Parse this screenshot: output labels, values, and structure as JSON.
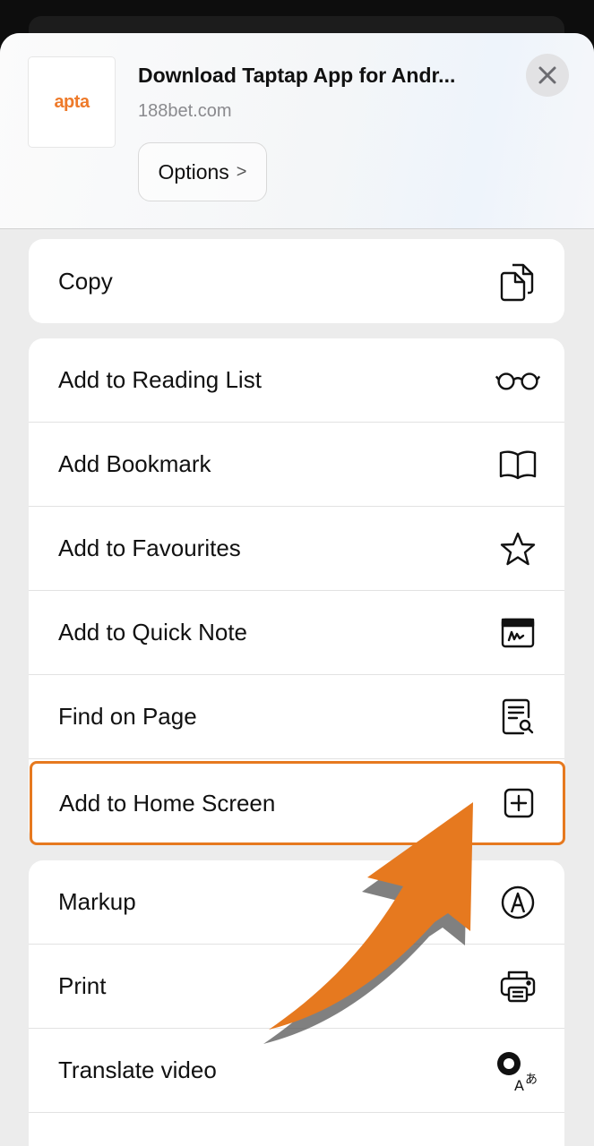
{
  "header": {
    "app_thumb_text": "apta",
    "title": "Download Taptap App for Andr...",
    "domain": "188bet.com",
    "options_label": "Options",
    "options_chevron": ">"
  },
  "actions": {
    "copy": "Copy",
    "reading_list": "Add to Reading List",
    "bookmark": "Add Bookmark",
    "favourites": "Add to Favourites",
    "quick_note": "Add to Quick Note",
    "find_on_page": "Find on Page",
    "home_screen": "Add to Home Screen",
    "markup": "Markup",
    "print": "Print",
    "translate_video": "Translate video"
  },
  "icons": {
    "copy": "copy-icon",
    "reading_list": "glasses-icon",
    "bookmark": "book-icon",
    "favourites": "star-icon",
    "quick_note": "quick-note-icon",
    "find_on_page": "find-document-icon",
    "home_screen": "plus-square-icon",
    "markup": "markup-pen-icon",
    "print": "printer-icon",
    "translate_video": "translate-icon"
  },
  "colors": {
    "accent": "#e6791f",
    "brand": "#ee7a2a"
  }
}
